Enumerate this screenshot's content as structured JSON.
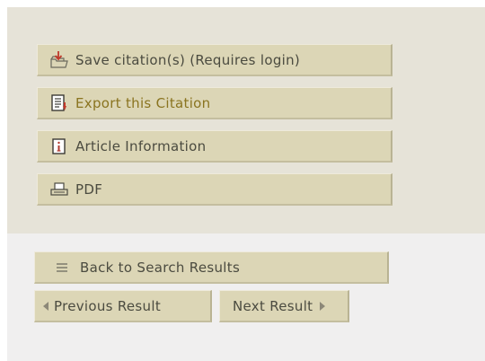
{
  "actions": {
    "save_label": "Save citation(s) (Requires login)",
    "export_label": "Export this Citation",
    "info_label": "Article Information",
    "pdf_label": "PDF"
  },
  "navigation": {
    "back_label": "Back to Search Results",
    "prev_label": "Previous Result",
    "next_label": "Next Result"
  },
  "icons": {
    "save": "folder-download-icon",
    "export": "export-document-icon",
    "info": "info-icon",
    "pdf": "printer-icon",
    "back": "list-icon",
    "prev": "triangle-left-icon",
    "next": "triangle-right-icon"
  },
  "colors": {
    "upper_panel": "#e6e3d8",
    "lower_panel": "#f0efef",
    "button_face": "#dcd6b6",
    "text": "#4b4b40",
    "accent_text": "#8a7420"
  }
}
